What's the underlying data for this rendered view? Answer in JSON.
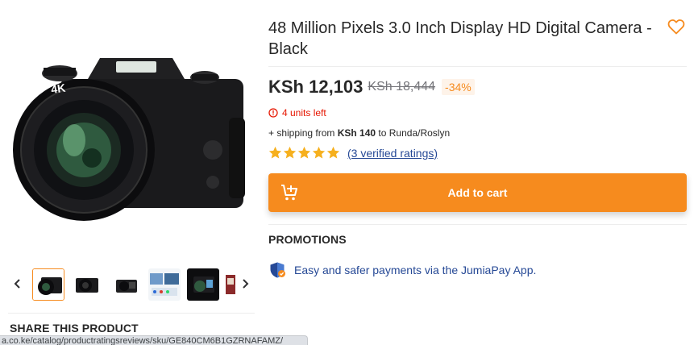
{
  "product": {
    "title": "48 Million Pixels 3.0 Inch Display HD Digital Camera - Black",
    "price": "KSh 12,103",
    "old_price": "KSh 18,444",
    "discount": "-34%",
    "stock": "4 units left",
    "shipping": {
      "prefix": "+ shipping from ",
      "amount": "KSh 140",
      "suffix": " to Runda/Roslyn"
    },
    "rating": {
      "stars": 5,
      "max_stars": 5,
      "link_label": "(3 verified ratings)"
    },
    "add_to_cart_label": "Add to cart"
  },
  "gallery": {
    "thumbnail_count": 6,
    "active_thumbnail": 1
  },
  "share_title": "SHARE THIS PRODUCT",
  "promotions": {
    "title": "PROMOTIONS",
    "items": [
      {
        "icon": "shield-icon",
        "text": "Easy and safer payments via the JumiaPay App."
      }
    ]
  },
  "status_bar_url": "a.co.ke/catalog/productratingsreviews/sku/GE840CM6B1GZRNAFAMZ/",
  "icons": {
    "wishlist": "heart-icon",
    "stock_warning": "warning-icon",
    "cart": "add-to-cart-icon",
    "prev": "chevron-left-icon",
    "next": "chevron-right-icon"
  },
  "colors": {
    "accent": "#f68b1e",
    "discount_bg": "#fef3e9",
    "stock_red": "#e61601",
    "link_blue": "#264996",
    "star": "#f6b01e"
  }
}
